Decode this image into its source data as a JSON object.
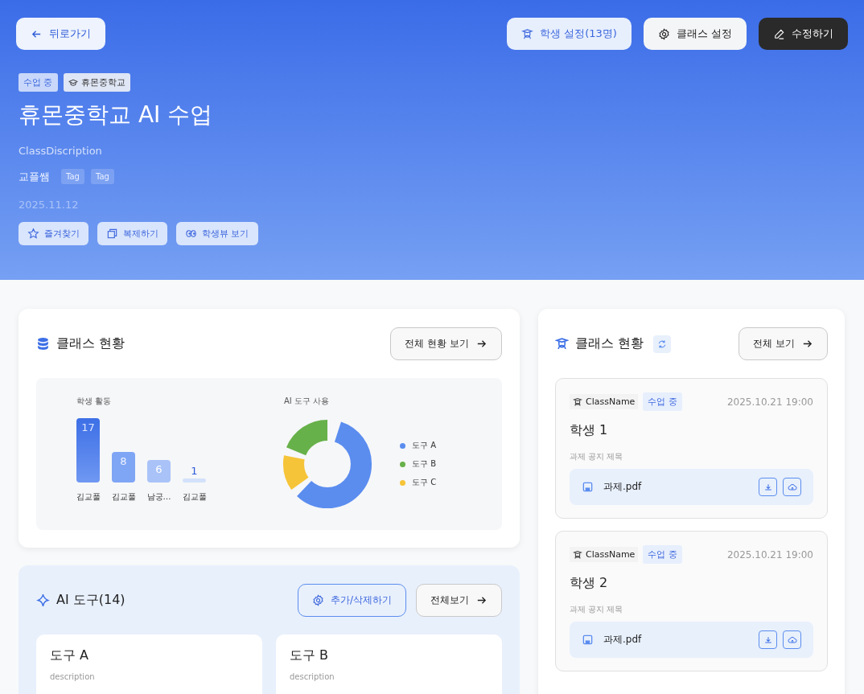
{
  "header": {
    "back_button": "뒤로가기",
    "buttons": [
      {
        "label": "학생 설정(13명)",
        "kind": "students"
      },
      {
        "label": "클래스 설정",
        "kind": "settings"
      },
      {
        "label": "수정하기",
        "kind": "edit"
      }
    ]
  },
  "class": {
    "status_badge": "수업 중",
    "school_badge": "휴몬중학교",
    "title": "휴몬중학교 AI 수업",
    "description": "ClassDiscription",
    "teacher": "교플쌤",
    "tags": [
      "Tag",
      "Tag"
    ],
    "date": "2025.11.12",
    "actions": [
      {
        "label": "즐겨찾기",
        "kind": "favorite"
      },
      {
        "label": "복제하기",
        "kind": "copy"
      },
      {
        "label": "학생뷰 보기",
        "kind": "view"
      }
    ]
  },
  "status_card": {
    "title": "클래스 현황",
    "button": "전체 현황 보기",
    "activity_chart": {
      "chart_data": {
        "type": "bar",
        "title": "학생 활동",
        "categories": [
          "김교풀",
          "김교풀",
          "남궁…",
          "김교풀"
        ],
        "values": [
          17,
          8,
          6,
          1
        ],
        "data_labels": true
      }
    },
    "usage_chart": {
      "title": "AI 도구 사용",
      "legend": [
        {
          "label": "도구 A",
          "color": "#5b8def"
        },
        {
          "label": "도구 B",
          "color": "#67b14a"
        },
        {
          "label": "도구 C",
          "color": "#f6c438"
        }
      ]
    }
  },
  "tools": {
    "title": "AI 도구(14)",
    "manage_button": "추가/삭제하기",
    "all_button": "전체보기",
    "items": [
      {
        "name": "도구 A",
        "description": "description"
      },
      {
        "name": "도구 B",
        "description": "description"
      }
    ]
  },
  "feed": {
    "title": "클래스 현황",
    "button": "전체 보기",
    "items": [
      {
        "class_name": "ClassName",
        "status": "수업 중",
        "time": "2025.10.21 19:00",
        "student": "학생 1",
        "notice": "과제 공지 제목",
        "file": "과제.pdf"
      },
      {
        "class_name": "ClassName",
        "status": "수업 중",
        "time": "2025.10.21 19:00",
        "student": "학생 2",
        "notice": "과제 공지 제목",
        "file": "과제.pdf"
      }
    ]
  }
}
